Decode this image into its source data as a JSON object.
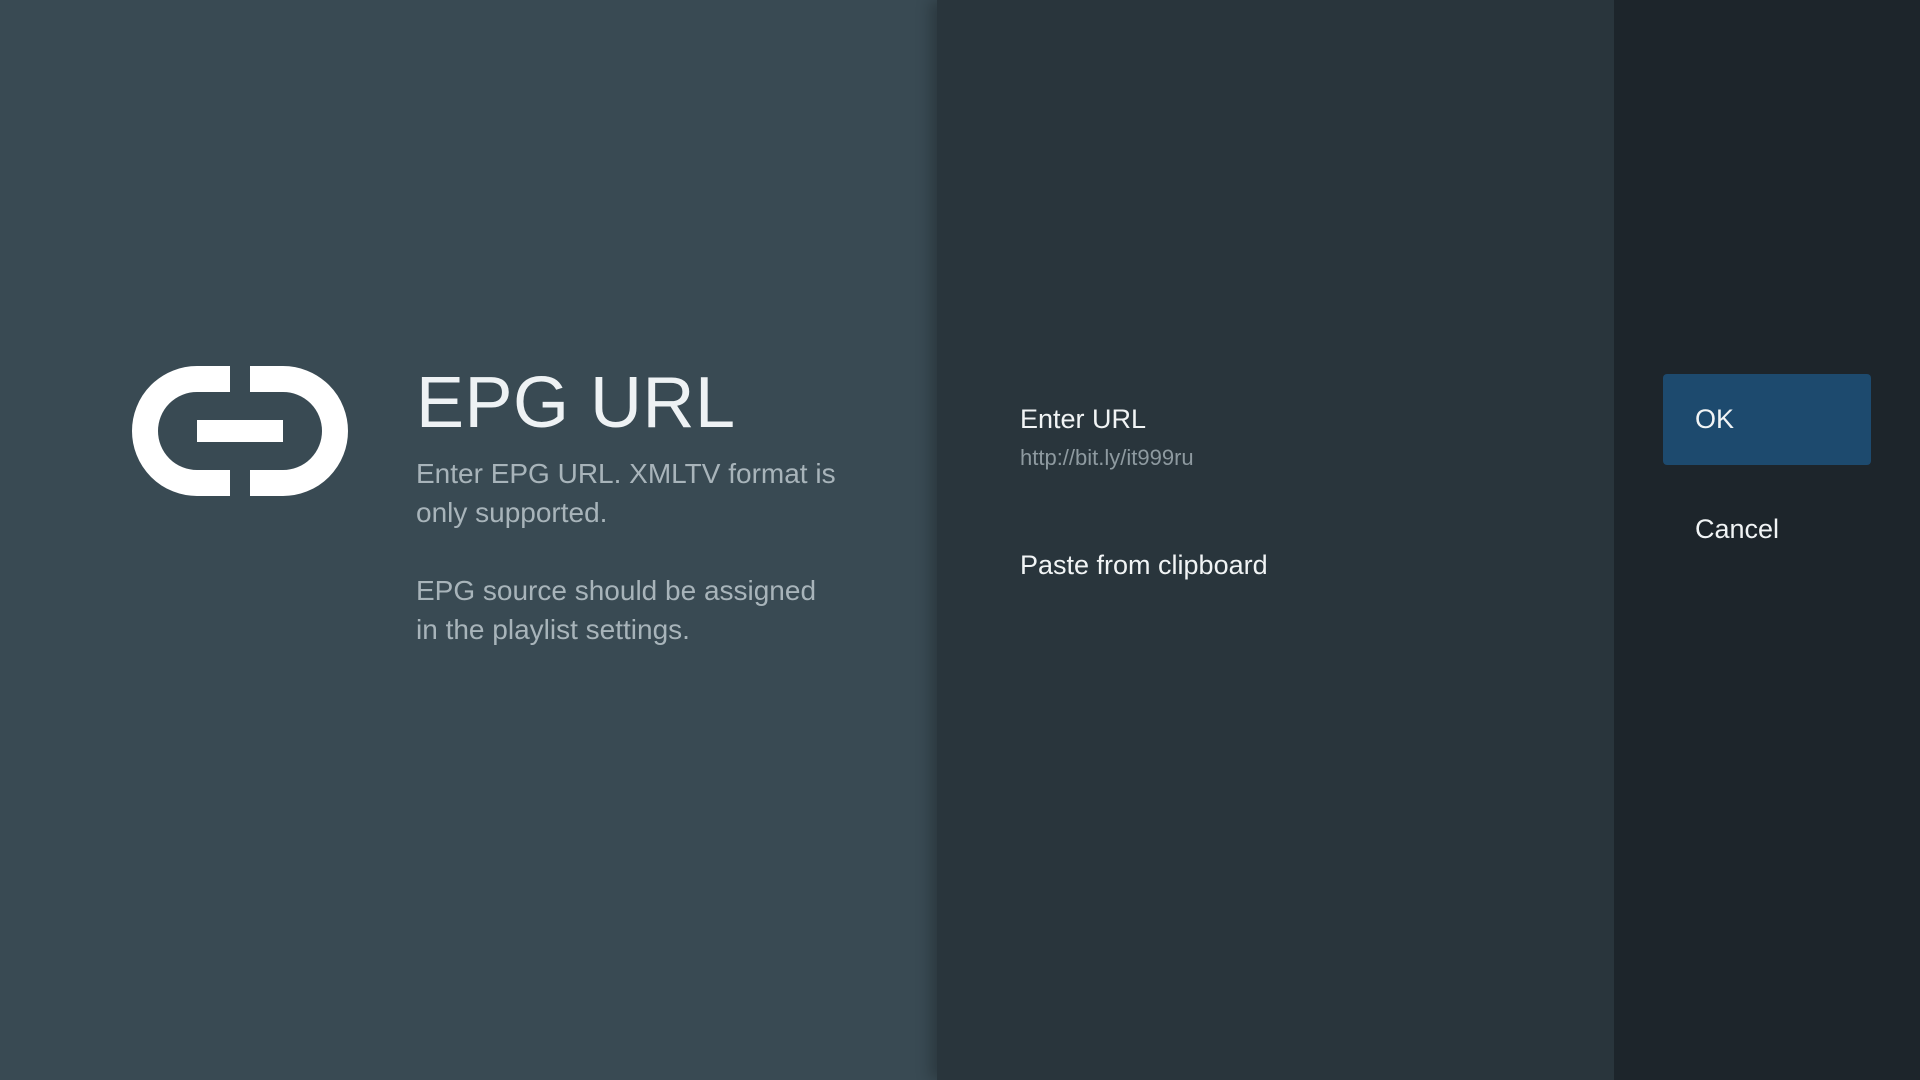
{
  "guidance": {
    "icon": "link-icon",
    "title": "EPG URL",
    "description": "Enter EPG URL. XMLTV format is only supported.",
    "note": "EPG source should be assigned in the playlist settings."
  },
  "actions": {
    "enter_url": {
      "title": "Enter URL",
      "description": "http://bit.ly/it999ru"
    },
    "paste": {
      "title": "Paste from clipboard"
    }
  },
  "buttons": {
    "ok": "OK",
    "cancel": "Cancel"
  },
  "colors": {
    "guidance_bg": "#394a53",
    "actions_bg": "#29353c",
    "buttons_bg": "#1d252b",
    "focused_button": "#1d4a6e"
  }
}
